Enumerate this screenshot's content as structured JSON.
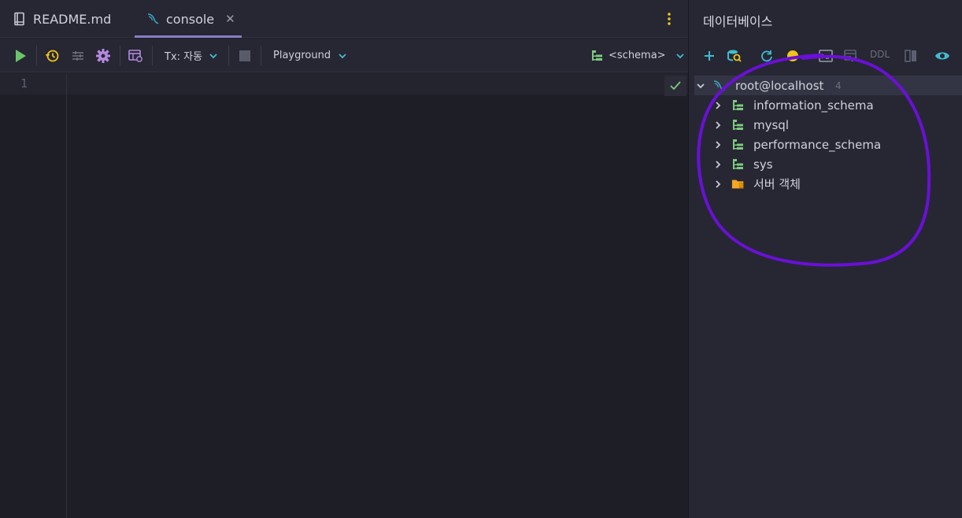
{
  "editor": {
    "tabs": [
      {
        "label": "README.md",
        "icon": "book-icon"
      },
      {
        "label": "console",
        "icon": "mysql-dolphin-icon",
        "active": true
      }
    ],
    "toolbar": {
      "tx_label": "Tx: 자동",
      "playground_label": "Playground",
      "schema_label": "<schema>"
    },
    "line_numbers": [
      "1"
    ]
  },
  "database": {
    "title": "데이터베이스",
    "ddl_label": "DDL",
    "root": {
      "label": "root@localhost",
      "count": "4"
    },
    "items": [
      {
        "label": "information_schema",
        "icon": "schema-icon"
      },
      {
        "label": "mysql",
        "icon": "schema-icon"
      },
      {
        "label": "performance_schema",
        "icon": "schema-icon"
      },
      {
        "label": "sys",
        "icon": "schema-icon"
      },
      {
        "label": "서버 객체",
        "icon": "folder-icon"
      }
    ]
  },
  "colors": {
    "run": "#6ac46a",
    "accent_purple": "#b58ae0",
    "teal": "#3fbcd0",
    "schema_green": "#7fc97f",
    "folder_orange": "#f5a623",
    "annotation": "#6a10d6"
  }
}
